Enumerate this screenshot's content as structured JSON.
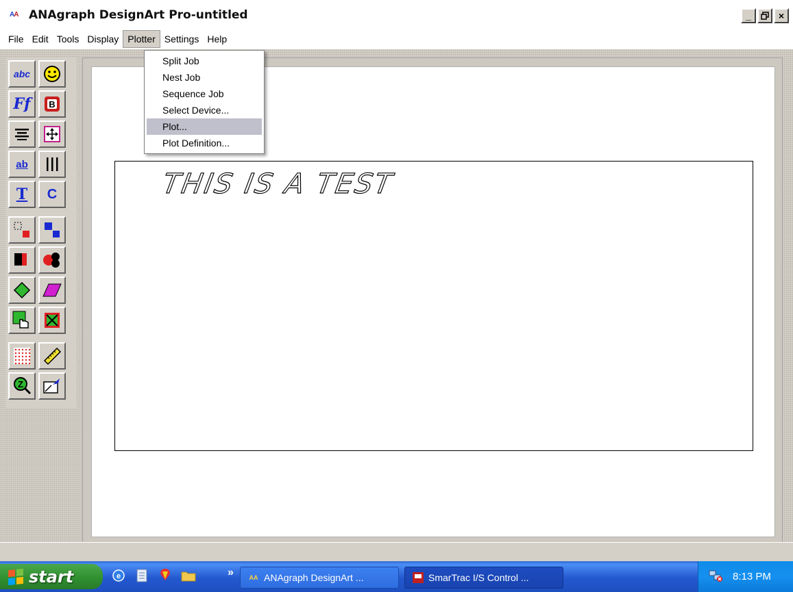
{
  "window": {
    "title": "ANAgraph DesignArt Pro-untitled",
    "app_icon_text": "AA",
    "controls": {
      "minimize": "_",
      "maximize": "̅□",
      "close": "×"
    }
  },
  "menubar": {
    "items": [
      "File",
      "Edit",
      "Tools",
      "Display",
      "Plotter",
      "Settings",
      "Help"
    ],
    "active": "Plotter"
  },
  "plotter_menu": {
    "items": [
      "Split Job",
      "Nest Job",
      "Sequence Job",
      "Select Device...",
      "Plot...",
      "Plot Definition..."
    ],
    "highlighted": "Plot..."
  },
  "canvas": {
    "text_object": "THIS IS A TEST"
  },
  "toolbox": {
    "tools": [
      {
        "name": "text-tool",
        "label": "abc"
      },
      {
        "name": "clipart-tool",
        "label": ""
      },
      {
        "name": "font-tool",
        "label": "Ff"
      },
      {
        "name": "bold-tool",
        "label": "B"
      },
      {
        "name": "align-tool",
        "label": ""
      },
      {
        "name": "move-tool",
        "label": ""
      },
      {
        "name": "text-spacing-tool",
        "label": "ab"
      },
      {
        "name": "bars-tool",
        "label": ""
      },
      {
        "name": "text-size-tool",
        "label": "T"
      },
      {
        "name": "convert-tool",
        "label": "C"
      }
    ]
  },
  "taskbar": {
    "start_label": "start",
    "more_glyph": "»",
    "tasks": [
      {
        "label": "ANAgraph DesignArt ...",
        "icon": "AA"
      },
      {
        "label": "SmarTrac I/S Control ...",
        "icon": ""
      }
    ],
    "clock": "8:13 PM"
  },
  "colors": {
    "taskbar_blue": "#2458d0",
    "start_green": "#2f8f2f",
    "tray_blue": "#1590f0",
    "menu_highlight": "#c0c0cc"
  }
}
